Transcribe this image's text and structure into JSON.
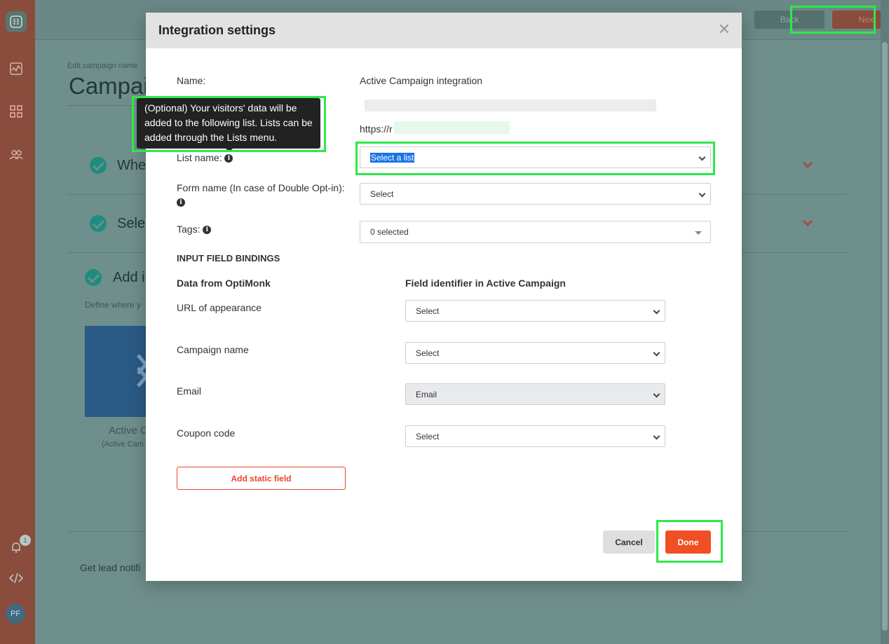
{
  "background": {
    "back_label": "Back",
    "next_label": "Next",
    "edit_label": "Edit campaign name",
    "campaign_title": "Campai",
    "step1_text": "Whe",
    "step2_text": "Sele",
    "step3_text": "Add i",
    "define_text": "Define where y",
    "ac_label": "Active C",
    "ac_sub": "(Active Cam",
    "lead_text": "Get lead notifi",
    "notification_count": "1",
    "avatar_initials": "PF"
  },
  "modal": {
    "title": "Integration settings",
    "name_label": "Name:",
    "name_value": "Active Campaign integration",
    "url_prefix": "https://r",
    "list_name_label": "List name:",
    "list_select_value": "Select a list",
    "form_name_label": "Form name (In case of Double Opt-in):",
    "form_select_value": "Select",
    "tags_label": "Tags:",
    "tags_value": "0 selected",
    "bindings_header": "INPUT FIELD BINDINGS",
    "col_left": "Data from OptiMonk",
    "col_right": "Field identifier in Active Campaign",
    "bindings": [
      {
        "label": "URL of appearance",
        "value": "Select"
      },
      {
        "label": "Campaign name",
        "value": "Select"
      },
      {
        "label": "Email",
        "value": "Email"
      },
      {
        "label": "Coupon code",
        "value": "Select"
      }
    ],
    "add_static_label": "Add static field",
    "cancel_label": "Cancel",
    "done_label": "Done"
  },
  "tooltip": {
    "text": "(Optional) Your visitors' data will be added to the following list. Lists can be added through the Lists menu."
  }
}
